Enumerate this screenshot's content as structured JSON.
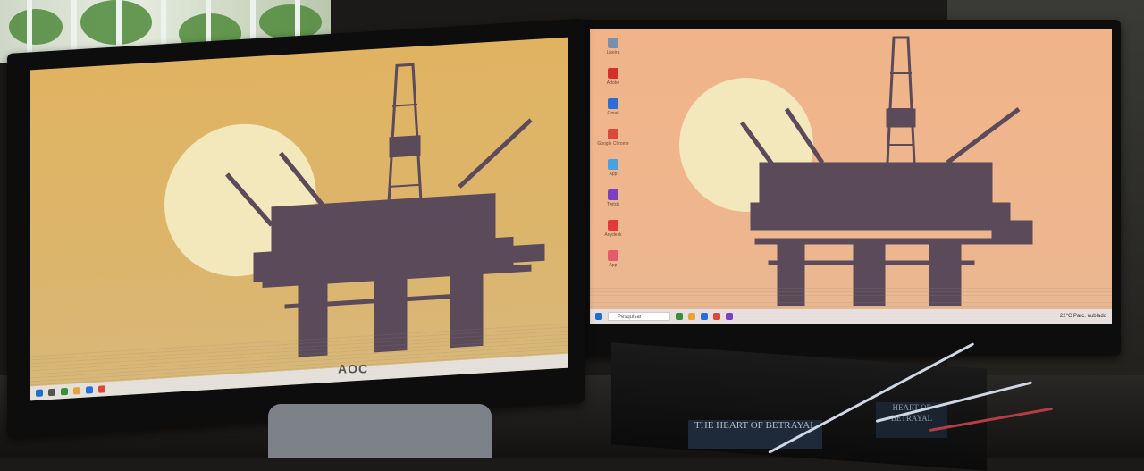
{
  "scene": {
    "caption": "",
    "left_monitor": {
      "brand": "AOC",
      "wallpaper": "offshore oil platform silhouette against sun",
      "sky_color": "#e0b361"
    },
    "right_monitor": {
      "wallpaper": "offshore oil platform silhouette against sun",
      "sky_color": "#f1b489",
      "taskbar": {
        "search_placeholder": "Pesquisar",
        "tray_weather": "22°C Parc. nublado"
      },
      "desktop_icons": [
        {
          "label": "Lixeira",
          "color": "#7a8fa8"
        },
        {
          "label": "Steam",
          "color": "#2a3e5c"
        },
        {
          "label": "Adobe",
          "color": "#d4302a"
        },
        {
          "label": "Epic Games",
          "color": "#222222"
        },
        {
          "label": "Gmail",
          "color": "#2b6fd6"
        },
        {
          "label": "Ubisoft",
          "color": "#3b6fa8"
        },
        {
          "label": "Google Chrome",
          "color": "#d9483b"
        },
        {
          "label": "App",
          "color": "#4aa0e0"
        },
        {
          "label": "Twitch",
          "color": "#7b3fc4"
        },
        {
          "label": "Anydesk",
          "color": "#e23a3a"
        },
        {
          "label": "App",
          "color": "#e45a6a"
        }
      ]
    },
    "books": [
      "THE HEART OF BETRAYAL",
      "HEART OF BETRAYAL"
    ]
  }
}
